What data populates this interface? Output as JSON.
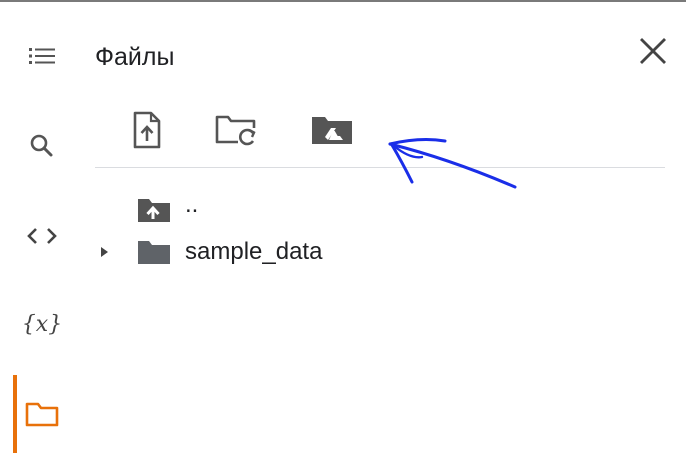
{
  "panel": {
    "title": "Файлы"
  },
  "sidebar": {
    "items": [
      {
        "icon": "table-of-contents-icon"
      },
      {
        "icon": "search-icon"
      },
      {
        "icon": "code-snippets-icon"
      },
      {
        "icon": "variables-icon",
        "label": "{x}"
      },
      {
        "icon": "folder-icon",
        "active": true
      }
    ],
    "active_color": "#e8710a"
  },
  "toolbar": {
    "buttons": [
      {
        "icon": "upload-file-icon"
      },
      {
        "icon": "refresh-folder-icon"
      },
      {
        "icon": "mount-drive-icon"
      }
    ]
  },
  "tree": {
    "items": [
      {
        "name": "..",
        "icon": "folder-up-icon",
        "expandable": false
      },
      {
        "name": "sample_data",
        "icon": "folder-icon",
        "expandable": true
      }
    ]
  },
  "annotation": {
    "color": "#1a2ee8",
    "shape": "hand-drawn-arrow"
  }
}
